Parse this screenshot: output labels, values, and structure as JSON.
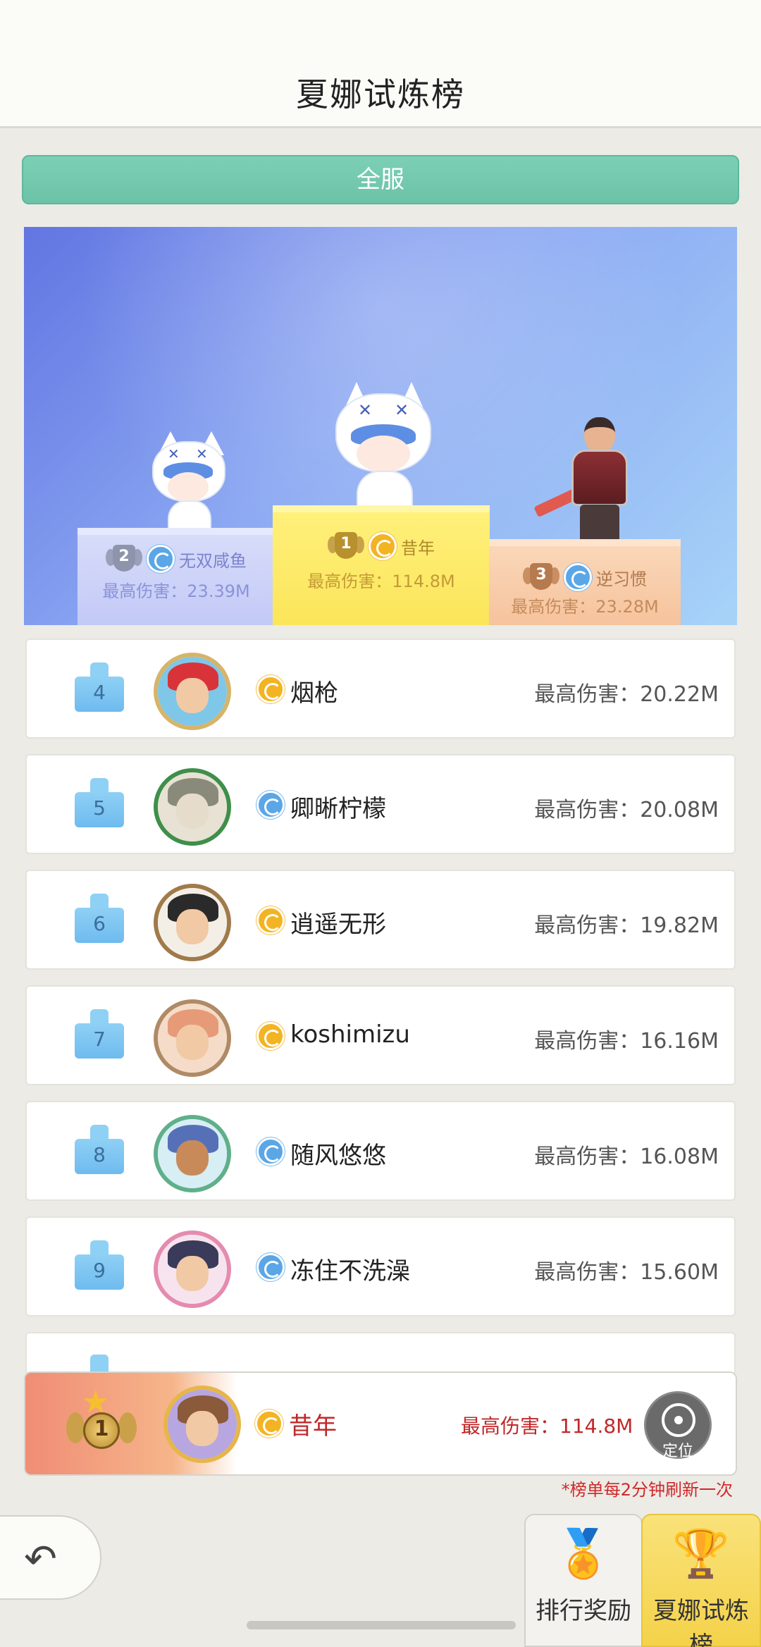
{
  "header": {
    "title": "夏娜试炼榜"
  },
  "server_button": {
    "label": "全服"
  },
  "podium": {
    "second": {
      "rank": "2",
      "name": "无双咸鱼",
      "damage": "最高伤害：23.39M",
      "faction": "blue"
    },
    "first": {
      "rank": "1",
      "name": "昔年",
      "damage": "最高伤害：114.8M",
      "faction": "gold"
    },
    "third": {
      "rank": "3",
      "name": "逆习惯",
      "damage": "最高伤害：23.28M",
      "faction": "blue"
    }
  },
  "rows": [
    {
      "rank": "4",
      "name": "烟枪",
      "damage": "最高伤害：20.22M",
      "faction": "gold"
    },
    {
      "rank": "5",
      "name": "卿晰柠檬",
      "damage": "最高伤害：20.08M",
      "faction": "blue"
    },
    {
      "rank": "6",
      "name": "逍遥无形",
      "damage": "最高伤害：19.82M",
      "faction": "gold"
    },
    {
      "rank": "7",
      "name": "koshimizu",
      "damage": "最高伤害：16.16M",
      "faction": "gold"
    },
    {
      "rank": "8",
      "name": "随风悠悠",
      "damage": "最高伤害：16.08M",
      "faction": "blue"
    },
    {
      "rank": "9",
      "name": "冻住不洗澡",
      "damage": "最高伤害：15.60M",
      "faction": "blue"
    }
  ],
  "my_row": {
    "rank": "1",
    "name": "昔年",
    "damage": "最高伤害：114.8M",
    "locate_label": "定位"
  },
  "refresh_note": "*榜单每2分钟刷新一次",
  "bottom_tabs": {
    "rank_reward": "排行奖励",
    "trial_board": "夏娜试炼榜"
  },
  "colors": {
    "accent_green": "#6cc3a8",
    "highlight_red": "#c0282a",
    "tab_active": "#f4d24a"
  }
}
